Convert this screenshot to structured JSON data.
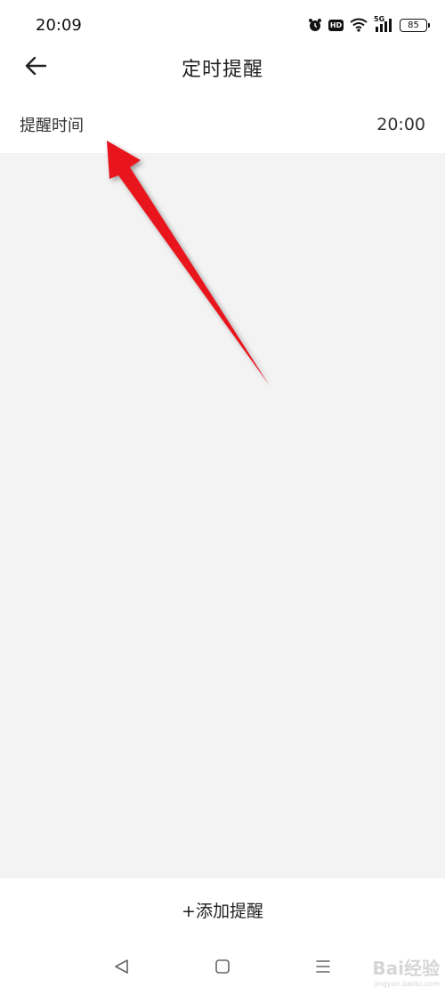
{
  "status_bar": {
    "time": "20:09",
    "hd_label": "HD",
    "network_label": "5G",
    "battery": "85",
    "icons": [
      "alarm-icon",
      "hd-icon",
      "wifi-icon",
      "signal-5g-icon",
      "battery-icon"
    ]
  },
  "header": {
    "title": "定时提醒",
    "back_icon": "arrow-left-icon"
  },
  "reminder": {
    "label": "提醒时间",
    "value": "20:00"
  },
  "footer": {
    "add_label": "+添加提醒"
  },
  "nav": {
    "icons": [
      "back-triangle-icon",
      "home-square-icon",
      "menu-lines-icon"
    ]
  },
  "annotation": {
    "color": "#e8121c"
  },
  "watermark": {
    "text": "Bai经验",
    "url": "jingyan.baidu.com"
  }
}
